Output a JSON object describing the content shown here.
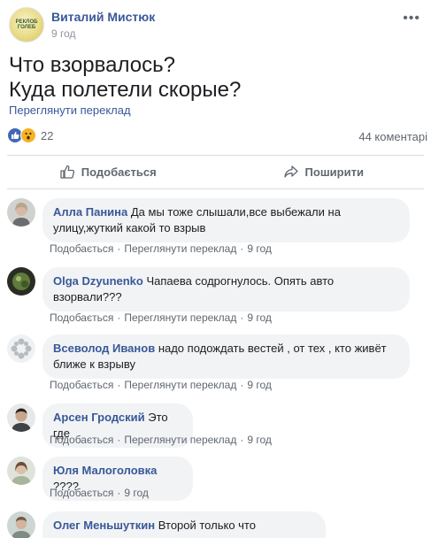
{
  "post": {
    "avatar_text": "РЕКЛОБ ГОЛЕБ",
    "author": "Виталий Мистюк",
    "time": "9 год",
    "text_line1": "Что взорвалось?",
    "text_line2": "Куда полетели скорые?",
    "translate": "Переглянути переклад",
    "reaction_count": "22",
    "comments_count": "44 коментарі"
  },
  "actions": {
    "like": "Подобається",
    "share": "Поширити"
  },
  "comments": [
    {
      "author": "Алла Панина",
      "text": "Да мы тоже слышали,все выбежали на улицу,жуткий какой то взрыв",
      "like": "Подобається",
      "translate": "Переглянути переклад",
      "time": "9 год"
    },
    {
      "author": "Olga Dzyunenko",
      "text": "Чапаева содрогнулось. Опять авто взорвали???",
      "like": "Подобається",
      "translate": "Переглянути переклад",
      "time": "9 год"
    },
    {
      "author": "Всеволод Иванов",
      "text": "надо подождать вестей , от тех , кто живёт ближе к взрыву",
      "like": "Подобається",
      "translate": "Переглянути переклад",
      "time": "9 год"
    },
    {
      "author": "Арсен Гродский",
      "text": "Это где",
      "like": "Подобається",
      "translate": "Переглянути переклад",
      "time": "9 год"
    },
    {
      "author": "Юля Малоголовка",
      "text": "????",
      "like": "Подобається",
      "time": "9 год"
    },
    {
      "author": "Олег Меньшуткин",
      "text": "Второй только что прогремел."
    }
  ],
  "colors": {
    "link": "#385898",
    "meta": "#606770",
    "bubble": "#f2f3f5",
    "like_blue": "#4267b2",
    "wow_yellow": "#f7b125"
  }
}
